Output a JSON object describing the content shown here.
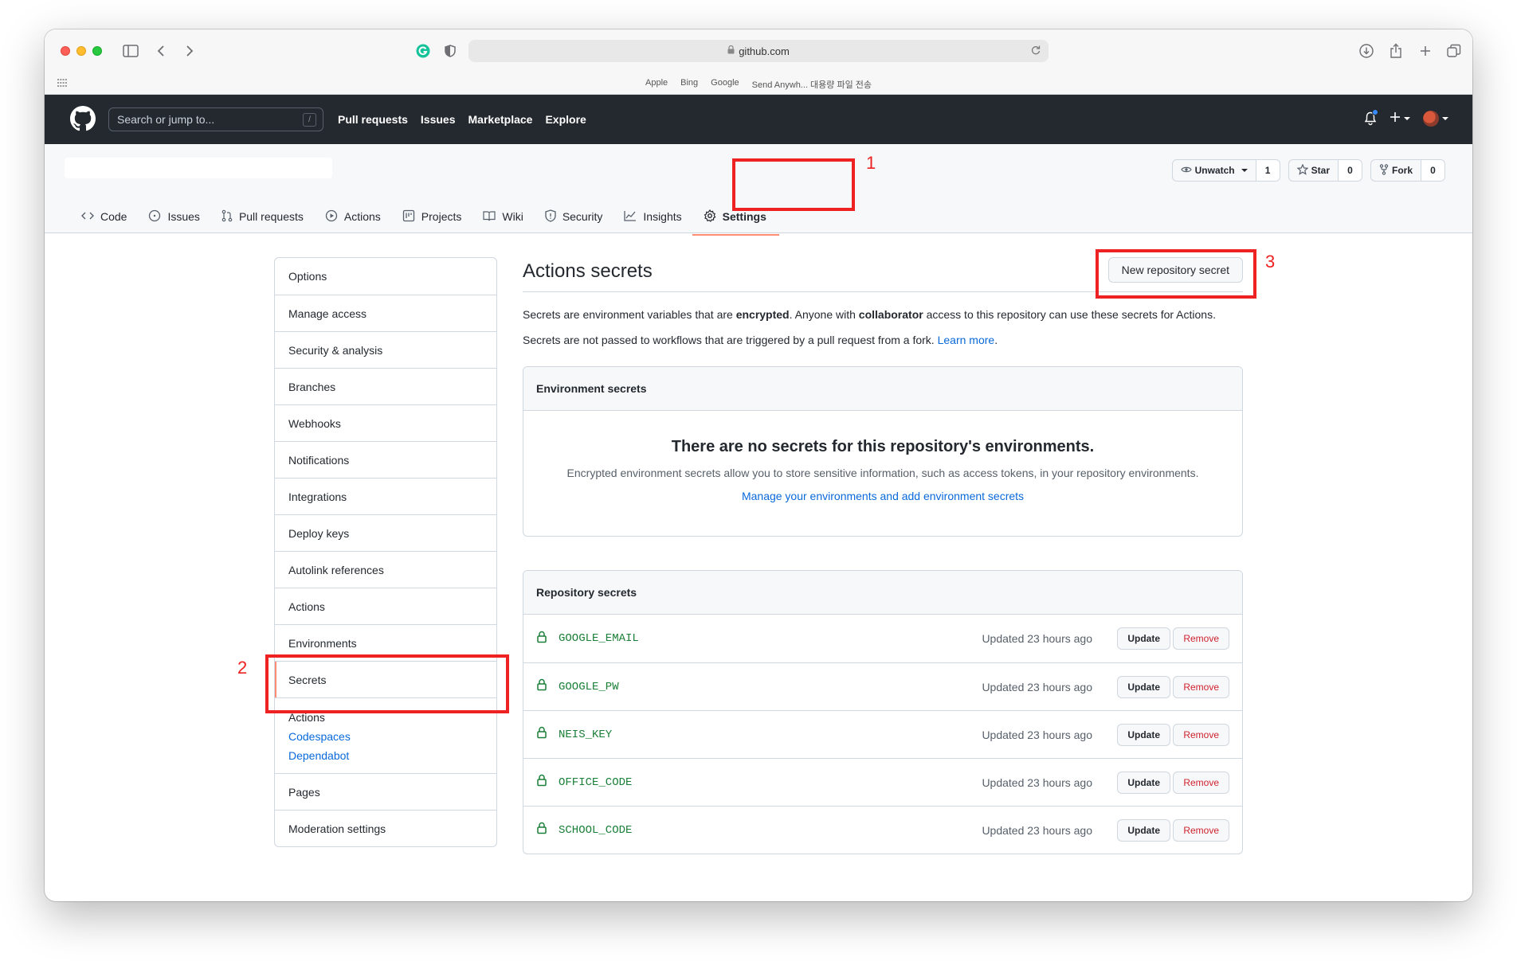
{
  "browser": {
    "url": "github.com",
    "favorites": [
      "Apple",
      "Bing",
      "Google",
      "Send Anywh... 대용량 파일 전송"
    ]
  },
  "header": {
    "search_placeholder": "Search or jump to...",
    "search_shortcut": "/",
    "nav": [
      "Pull requests",
      "Issues",
      "Marketplace",
      "Explore"
    ]
  },
  "repo": {
    "watch_label": "Unwatch",
    "watch_count": "1",
    "star_label": "Star",
    "star_count": "0",
    "fork_label": "Fork",
    "fork_count": "0",
    "tabs": [
      {
        "label": "Code",
        "icon": "code-icon"
      },
      {
        "label": "Issues",
        "icon": "issue-icon"
      },
      {
        "label": "Pull requests",
        "icon": "pull-request-icon"
      },
      {
        "label": "Actions",
        "icon": "play-icon"
      },
      {
        "label": "Projects",
        "icon": "project-icon"
      },
      {
        "label": "Wiki",
        "icon": "book-icon"
      },
      {
        "label": "Security",
        "icon": "shield-icon"
      },
      {
        "label": "Insights",
        "icon": "graph-icon"
      },
      {
        "label": "Settings",
        "icon": "gear-icon",
        "selected": true
      }
    ]
  },
  "sidebar": {
    "items": [
      "Options",
      "Manage access",
      "Security & analysis",
      "Branches",
      "Webhooks",
      "Notifications",
      "Integrations",
      "Deploy keys",
      "Autolink references",
      "Actions",
      "Environments",
      "Secrets"
    ],
    "selected": "Secrets",
    "sub_heading": "Actions",
    "sub_links": [
      "Codespaces",
      "Dependabot"
    ],
    "bottom_items": [
      "Pages",
      "Moderation settings"
    ]
  },
  "main": {
    "title": "Actions secrets",
    "new_secret_button": "New repository secret",
    "desc1_pre": "Secrets are environment variables that are ",
    "desc1_bold1": "encrypted",
    "desc1_mid": ". Anyone with ",
    "desc1_bold2": "collaborator",
    "desc1_post": " access to this repository can use these secrets for Actions.",
    "desc2_pre": "Secrets are not passed to workflows that are triggered by a pull request from a fork. ",
    "desc2_link": "Learn more",
    "desc2_post": ".",
    "env": {
      "header": "Environment secrets",
      "empty_title": "There are no secrets for this repository's environments.",
      "empty_text": "Encrypted environment secrets allow you to store sensitive information, such as access tokens, in your repository environments.",
      "empty_link": "Manage your environments and add environment secrets"
    },
    "repo_secrets": {
      "header": "Repository secrets",
      "update_label": "Update",
      "remove_label": "Remove",
      "items": [
        {
          "name": "GOOGLE_EMAIL",
          "updated": "Updated 23 hours ago"
        },
        {
          "name": "GOOGLE_PW",
          "updated": "Updated 23 hours ago"
        },
        {
          "name": "NEIS_KEY",
          "updated": "Updated 23 hours ago"
        },
        {
          "name": "OFFICE_CODE",
          "updated": "Updated 23 hours ago"
        },
        {
          "name": "SCHOOL_CODE",
          "updated": "Updated 23 hours ago"
        }
      ]
    }
  },
  "annotations": [
    "1",
    "2",
    "3"
  ],
  "colors": {
    "annotation": "#ee2222",
    "header_bg": "#24292f",
    "link": "#0969da",
    "secret_name": "#1a7f37",
    "danger": "#cf222e",
    "tab_underline": "#fd8c73"
  }
}
